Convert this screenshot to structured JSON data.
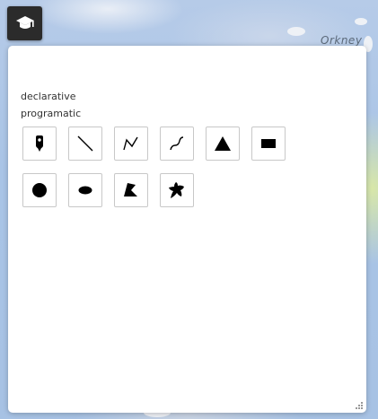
{
  "map": {
    "place_label": "Orkney",
    "colors": {
      "water": "#a9c4e6",
      "land": "#eef1f6",
      "highlight": "#d8e7a8"
    }
  },
  "toolbar": {
    "toggle_icon": "graduation-cap-icon"
  },
  "panel": {
    "modes": [
      "declarative",
      "programatic"
    ],
    "tools_row1": [
      {
        "name": "marker-tool",
        "icon": "map-marker-icon"
      },
      {
        "name": "line-tool",
        "icon": "straight-line-icon"
      },
      {
        "name": "polyline-tool",
        "icon": "polyline-icon"
      },
      {
        "name": "freehand-line-tool",
        "icon": "freehand-curve-icon"
      },
      {
        "name": "triangle-tool",
        "icon": "triangle-icon"
      },
      {
        "name": "rectangle-tool",
        "icon": "rectangle-icon"
      }
    ],
    "tools_row2": [
      {
        "name": "circle-tool",
        "icon": "circle-icon"
      },
      {
        "name": "ellipse-tool",
        "icon": "ellipse-icon"
      },
      {
        "name": "polygon-tool",
        "icon": "polygon-icon"
      },
      {
        "name": "freehand-polygon-tool",
        "icon": "freehand-polygon-icon"
      }
    ]
  }
}
